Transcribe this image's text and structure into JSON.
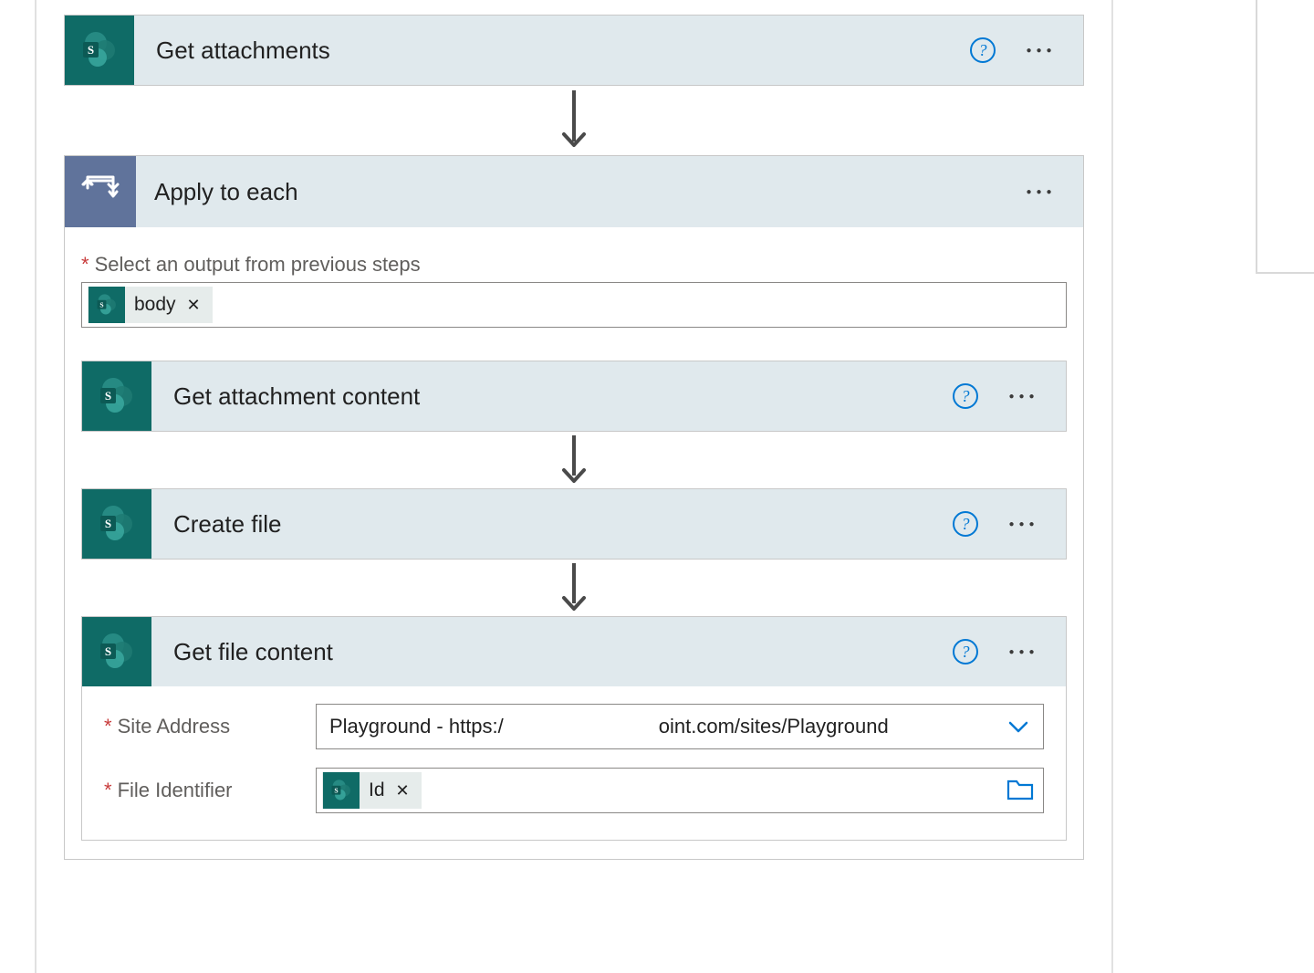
{
  "steps": {
    "get_attachments": {
      "title": "Get attachments"
    },
    "apply_to_each": {
      "title": "Apply to each",
      "select_output_label": "Select an output from previous steps",
      "token_body": "body"
    },
    "get_attachment_content": {
      "title": "Get attachment content"
    },
    "create_file": {
      "title": "Create file"
    },
    "get_file_content": {
      "title": "Get file content",
      "site_address_label": "Site Address",
      "site_address_value_left": "Playground - https:/",
      "site_address_value_right": "oint.com/sites/Playground",
      "file_identifier_label": "File Identifier",
      "token_id": "Id"
    }
  }
}
